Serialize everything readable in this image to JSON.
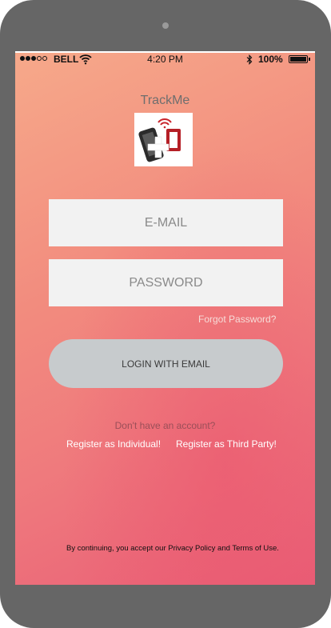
{
  "status_bar": {
    "carrier": "BELL",
    "time": "4:20 PM",
    "battery": "100%",
    "signal_bars_filled": 3,
    "signal_bars_total": 5
  },
  "app": {
    "title": "TrackMe",
    "logo_icon": "phone-plus-logo-icon"
  },
  "form": {
    "email_placeholder": "E-MAIL",
    "password_placeholder": "PASSWORD",
    "forgot_password": "Forgot Password?",
    "login_button": "LOGIN WITH EMAIL"
  },
  "register": {
    "prompt": "Don't have an account?",
    "individual": "Register as Individual!",
    "third_party": "Register as Third Party!"
  },
  "footer": {
    "terms": "By continuing, you accept our Privacy Policy and Terms of Use."
  },
  "colors": {
    "device": "#666666",
    "gradient_start": "#f6a98a",
    "gradient_end": "#e95d76",
    "input_bg": "#f2f2f2",
    "button_bg": "#c7cbcd"
  }
}
